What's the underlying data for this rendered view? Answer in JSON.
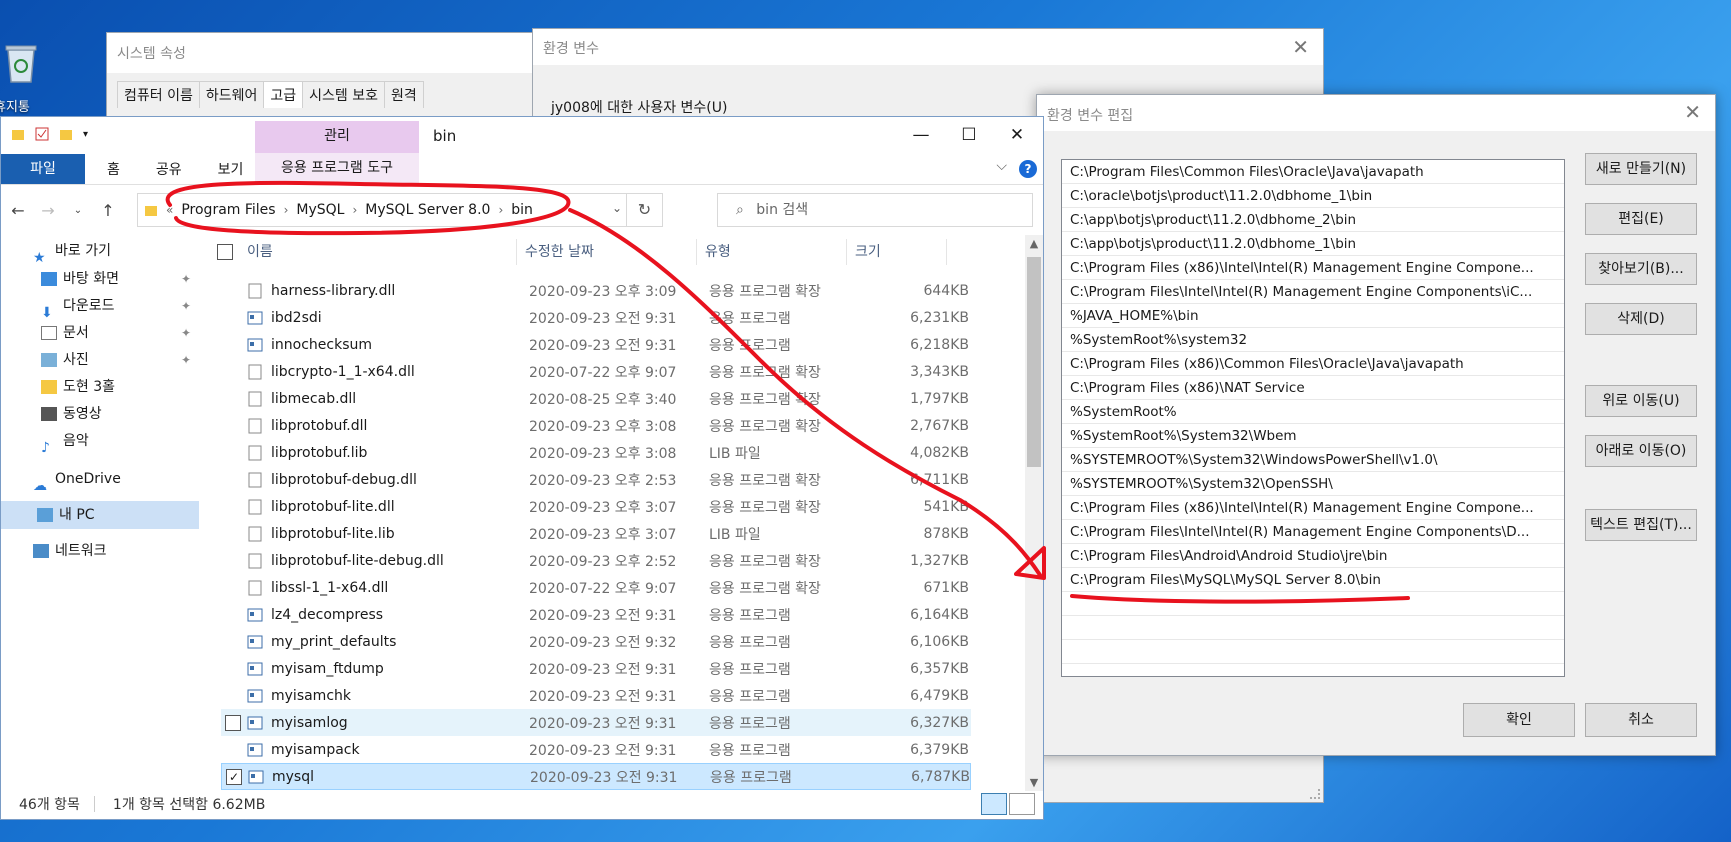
{
  "desktop": {
    "recycle_label": "휴지통"
  },
  "sysprop": {
    "title": "시스템 속성",
    "tabs": [
      "컴퓨터 이름",
      "하드웨어",
      "고급",
      "시스템 보호",
      "원격"
    ]
  },
  "envvar": {
    "title": "환경 변수",
    "user_vars_label": "jy008에 대한 사용자 변수(U)"
  },
  "editvar": {
    "title": "환경 변수 편집",
    "paths": [
      "C:\\Program Files\\Common Files\\Oracle\\Java\\javapath",
      "C:\\oracle\\botjs\\product\\11.2.0\\dbhome_1\\bin",
      "C:\\app\\botjs\\product\\11.2.0\\dbhome_2\\bin",
      "C:\\app\\botjs\\product\\11.2.0\\dbhome_1\\bin",
      "C:\\Program Files (x86)\\Intel\\Intel(R) Management Engine Compone...",
      "C:\\Program Files\\Intel\\Intel(R) Management Engine Components\\iC...",
      "%JAVA_HOME%\\bin",
      "%SystemRoot%\\system32",
      "C:\\Program Files (x86)\\Common Files\\Oracle\\Java\\javapath",
      "C:\\Program Files (x86)\\NAT Service",
      "%SystemRoot%",
      "%SystemRoot%\\System32\\Wbem",
      "%SYSTEMROOT%\\System32\\WindowsPowerShell\\v1.0\\",
      "%SYSTEMROOT%\\System32\\OpenSSH\\",
      "C:\\Program Files (x86)\\Intel\\Intel(R) Management Engine Compone...",
      "C:\\Program Files\\Intel\\Intel(R) Management Engine Components\\D...",
      "C:\\Program Files\\Android\\Android Studio\\jre\\bin",
      "C:\\Program Files\\MySQL\\MySQL Server 8.0\\bin"
    ],
    "buttons": {
      "new": "새로 만들기(N)",
      "edit": "편집(E)",
      "browse": "찾아보기(B)...",
      "delete": "삭제(D)",
      "move_up": "위로 이동(U)",
      "move_down": "아래로 이동(O)",
      "edit_text": "텍스트 편집(T)...",
      "ok": "확인",
      "cancel": "취소"
    }
  },
  "explorer": {
    "manage_tab": "관리",
    "title": "bin",
    "ribbon": {
      "file": "파일",
      "home": "홈",
      "share": "공유",
      "view": "보기",
      "app_tools": "응용 프로그램 도구"
    },
    "breadcrumb": [
      "Program Files",
      "MySQL",
      "MySQL Server 8.0",
      "bin"
    ],
    "search_placeholder": "bin 검색",
    "nav": {
      "quick_access": "바로 가기",
      "desktop": "바탕 화면",
      "downloads": "다운로드",
      "documents": "문서",
      "pictures": "사진",
      "library3": "도현 3홀",
      "videos": "동영상",
      "music": "음악",
      "onedrive": "OneDrive",
      "thispc": "내 PC",
      "network": "네트워크"
    },
    "columns": {
      "name": "이름",
      "date": "수정한 날짜",
      "type": "유형",
      "size": "크기"
    },
    "files": [
      {
        "name": "harness-library.dll",
        "date": "2020-09-23 오후 3:09",
        "type": "응용 프로그램 확장",
        "size": "644KB"
      },
      {
        "name": "ibd2sdi",
        "date": "2020-09-23 오전 9:31",
        "type": "응용 프로그램",
        "size": "6,231KB"
      },
      {
        "name": "innochecksum",
        "date": "2020-09-23 오전 9:31",
        "type": "응용 프로그램",
        "size": "6,218KB"
      },
      {
        "name": "libcrypto-1_1-x64.dll",
        "date": "2020-07-22 오후 9:07",
        "type": "응용 프로그램 확장",
        "size": "3,343KB"
      },
      {
        "name": "libmecab.dll",
        "date": "2020-08-25 오후 3:40",
        "type": "응용 프로그램 확장",
        "size": "1,797KB"
      },
      {
        "name": "libprotobuf.dll",
        "date": "2020-09-23 오후 3:08",
        "type": "응용 프로그램 확장",
        "size": "2,767KB"
      },
      {
        "name": "libprotobuf.lib",
        "date": "2020-09-23 오후 3:08",
        "type": "LIB 파일",
        "size": "4,082KB"
      },
      {
        "name": "libprotobuf-debug.dll",
        "date": "2020-09-23 오후 2:53",
        "type": "응용 프로그램 확장",
        "size": "6,711KB"
      },
      {
        "name": "libprotobuf-lite.dll",
        "date": "2020-09-23 오후 3:07",
        "type": "응용 프로그램 확장",
        "size": "541KB"
      },
      {
        "name": "libprotobuf-lite.lib",
        "date": "2020-09-23 오후 3:07",
        "type": "LIB 파일",
        "size": "878KB"
      },
      {
        "name": "libprotobuf-lite-debug.dll",
        "date": "2020-09-23 오후 2:52",
        "type": "응용 프로그램 확장",
        "size": "1,327KB"
      },
      {
        "name": "libssl-1_1-x64.dll",
        "date": "2020-07-22 오후 9:07",
        "type": "응용 프로그램 확장",
        "size": "671KB"
      },
      {
        "name": "lz4_decompress",
        "date": "2020-09-23 오전 9:31",
        "type": "응용 프로그램",
        "size": "6,164KB"
      },
      {
        "name": "my_print_defaults",
        "date": "2020-09-23 오전 9:32",
        "type": "응용 프로그램",
        "size": "6,106KB"
      },
      {
        "name": "myisam_ftdump",
        "date": "2020-09-23 오전 9:31",
        "type": "응용 프로그램",
        "size": "6,357KB"
      },
      {
        "name": "myisamchk",
        "date": "2020-09-23 오전 9:31",
        "type": "응용 프로그램",
        "size": "6,479KB"
      },
      {
        "name": "myisamlog",
        "date": "2020-09-23 오전 9:31",
        "type": "응용 프로그램",
        "size": "6,327KB"
      },
      {
        "name": "myisampack",
        "date": "2020-09-23 오전 9:31",
        "type": "응용 프로그램",
        "size": "6,379KB"
      },
      {
        "name": "mysql",
        "date": "2020-09-23 오전 9:31",
        "type": "응용 프로그램",
        "size": "6,787KB"
      }
    ],
    "status": {
      "count": "46개 항목",
      "selected": "1개 항목 선택함 6.62MB"
    }
  },
  "colors": {
    "accent": "#1a5fb0",
    "manage_tab": "#e8c9ee",
    "annotation": "#e8121e",
    "desktop": "#1a78d6"
  }
}
